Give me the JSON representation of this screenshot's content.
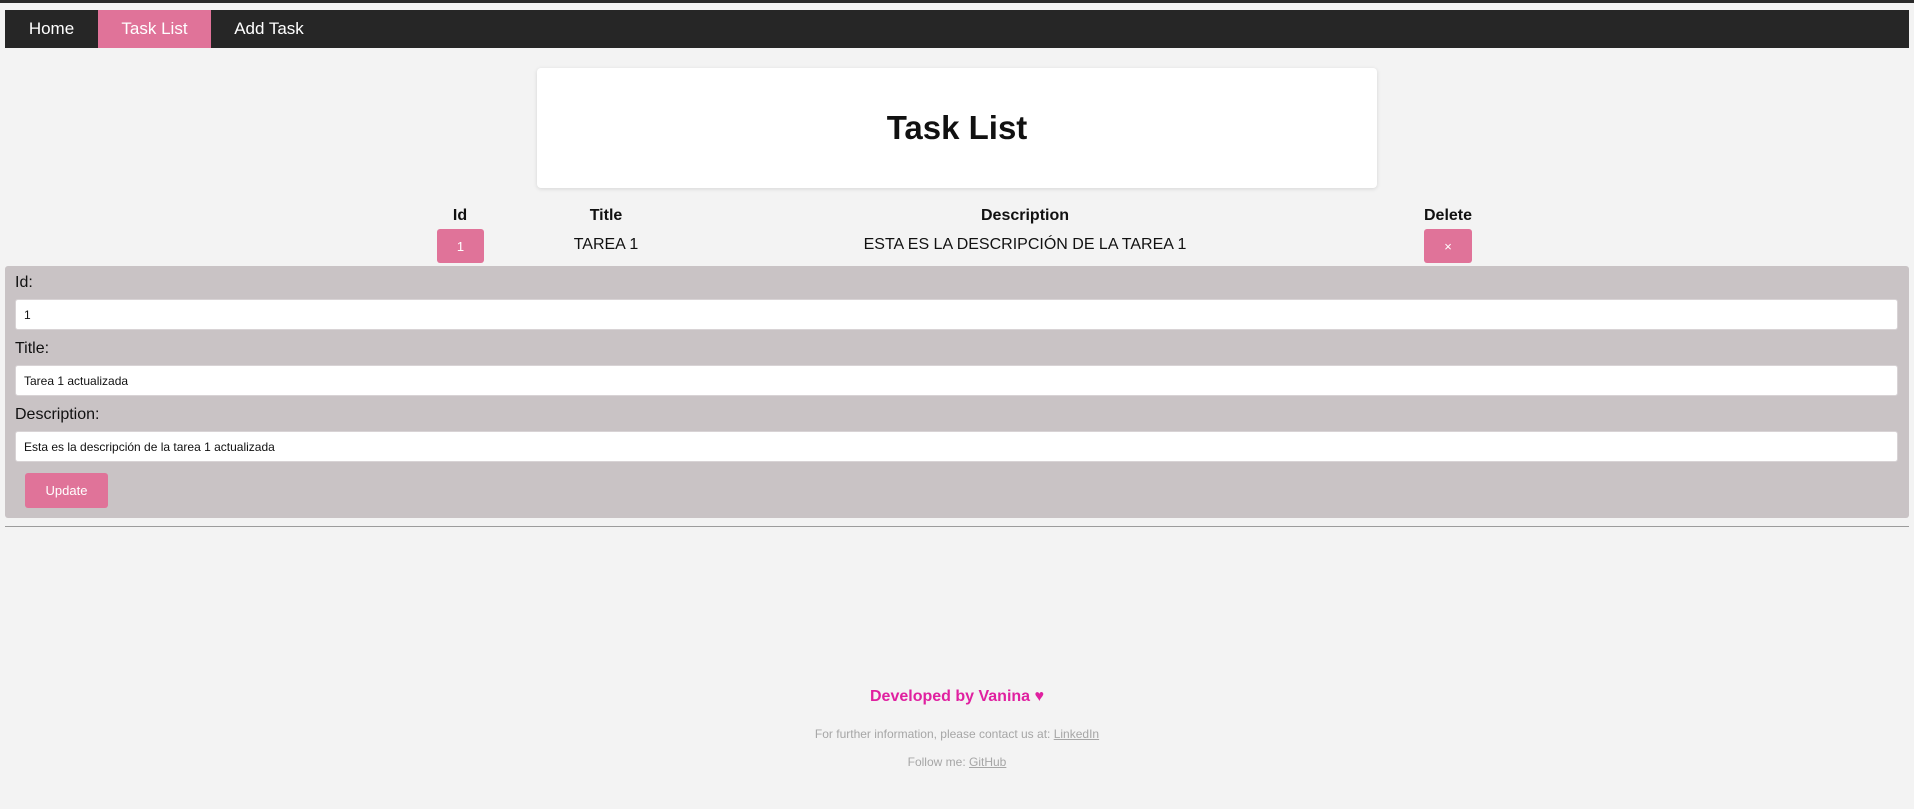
{
  "nav": {
    "items": [
      {
        "label": "Home"
      },
      {
        "label": "Task List"
      },
      {
        "label": "Add Task"
      }
    ],
    "active_color": "#e07399",
    "bar_color": "#262626"
  },
  "page_title": "Task List",
  "table": {
    "headers": [
      "Id",
      "Title",
      "Description",
      "Delete"
    ],
    "rows": [
      {
        "id": "1",
        "title": "TAREA 1",
        "description": "ESTA ES LA DESCRIPCIÓN DE LA TAREA 1",
        "delete": "×"
      }
    ]
  },
  "form": {
    "id_label": "Id:",
    "id_value": "1",
    "title_label": "Title:",
    "title_value": "Tarea 1 actualizada",
    "description_label": "Description:",
    "description_value": "Esta es la descripción de la tarea 1 actualizada",
    "update_label": "Update"
  },
  "footer": {
    "developed_by": "Developed by Vanina ♥",
    "contact_text": "For further information, please contact us at:",
    "contact_link": "LinkedIn",
    "follow_text": "Follow me:",
    "follow_link": "GitHub"
  },
  "colors": {
    "accent": "#e07399",
    "footer_accent": "#e020a0",
    "form_panel": "#c9c3c5",
    "background": "#f3f3f3"
  }
}
